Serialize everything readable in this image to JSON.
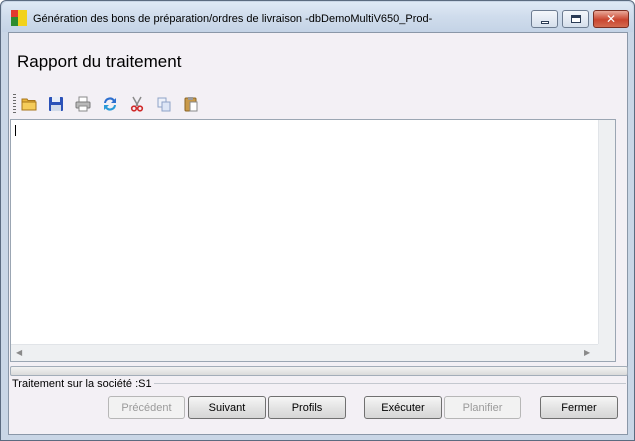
{
  "window": {
    "title": "Génération des bons de préparation/ordres de livraison -dbDemoMultiV650_Prod-"
  },
  "report": {
    "heading": "Rapport du traitement",
    "content": ""
  },
  "toolbar": {
    "icons": [
      "folder-open-icon",
      "save-icon",
      "print-icon",
      "refresh-icon",
      "cut-icon",
      "copy-icon",
      "paste-icon"
    ]
  },
  "status": {
    "text": "Traitement sur la société :S1"
  },
  "progress": {
    "value": 0
  },
  "buttons": {
    "previous": "Précédent",
    "next": "Suivant",
    "profiles": "Profils",
    "execute": "Exécuter",
    "schedule": "Planifier",
    "close": "Fermer"
  },
  "colors": {
    "client_background": "#f3f0f5",
    "title_gradient_top": "#dfe9f5",
    "close_button": "#c9452f"
  }
}
